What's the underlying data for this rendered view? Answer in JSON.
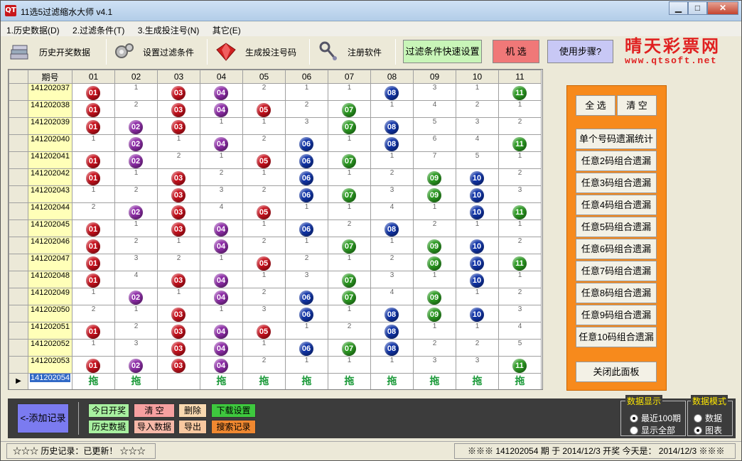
{
  "window": {
    "title": "11选5过滤缩水大师 v4.1",
    "min": "▁",
    "max": "□",
    "close": "✕",
    "app_icon": "QT"
  },
  "menu": [
    "1.历史数据(D)",
    "2.过滤条件(T)",
    "3.生成投注号(N)",
    "其它(E)"
  ],
  "toolbar": {
    "history": "历史开奖数据",
    "filter": "设置过滤条件",
    "generate": "生成投注号码",
    "register": "注册软件",
    "quick_filter": "过滤条件快速设置",
    "random": "机 选",
    "help": "使用步骤?",
    "colors": {
      "quick_filter": "#c8f5b8",
      "random": "#f07878",
      "help": "#c8c8f5"
    }
  },
  "brand": {
    "name": "晴天彩票网",
    "url": "www.qtsoft.net"
  },
  "grid": {
    "headers": [
      "期号",
      "01",
      "02",
      "03",
      "04",
      "05",
      "06",
      "07",
      "08",
      "09",
      "10",
      "11"
    ],
    "rows": [
      {
        "period": "141202037",
        "cells": [
          "01",
          "1",
          "03",
          "04",
          "2",
          "1",
          "1",
          "08",
          "3",
          "1",
          "11"
        ]
      },
      {
        "period": "141202038",
        "cells": [
          "01",
          "2",
          "03",
          "04",
          "05",
          "2",
          "07",
          "1",
          "4",
          "2",
          "1"
        ]
      },
      {
        "period": "141202039",
        "cells": [
          "01",
          "02",
          "03",
          "1",
          "1",
          "3",
          "07",
          "08",
          "5",
          "3",
          "2"
        ]
      },
      {
        "period": "141202040",
        "cells": [
          "1",
          "02",
          "1",
          "04",
          "2",
          "06",
          "1",
          "08",
          "6",
          "4",
          "11"
        ]
      },
      {
        "period": "141202041",
        "cells": [
          "01",
          "02",
          "2",
          "1",
          "05",
          "06",
          "07",
          "1",
          "7",
          "5",
          "1"
        ]
      },
      {
        "period": "141202042",
        "cells": [
          "01",
          "1",
          "03",
          "2",
          "1",
          "06",
          "1",
          "2",
          "09",
          "10",
          "2"
        ]
      },
      {
        "period": "141202043",
        "cells": [
          "1",
          "2",
          "03",
          "3",
          "2",
          "06",
          "07",
          "3",
          "09",
          "10",
          "3"
        ]
      },
      {
        "period": "141202044",
        "cells": [
          "2",
          "02",
          "03",
          "4",
          "05",
          "1",
          "1",
          "4",
          "1",
          "10",
          "11"
        ]
      },
      {
        "period": "141202045",
        "cells": [
          "01",
          "1",
          "03",
          "04",
          "1",
          "06",
          "2",
          "08",
          "2",
          "1",
          "1"
        ]
      },
      {
        "period": "141202046",
        "cells": [
          "01",
          "2",
          "1",
          "04",
          "2",
          "1",
          "07",
          "1",
          "09",
          "10",
          "2"
        ]
      },
      {
        "period": "141202047",
        "cells": [
          "01",
          "3",
          "2",
          "1",
          "05",
          "2",
          "1",
          "2",
          "09",
          "10",
          "11"
        ]
      },
      {
        "period": "141202048",
        "cells": [
          "01",
          "4",
          "03",
          "04",
          "1",
          "3",
          "07",
          "3",
          "1",
          "10",
          "1"
        ]
      },
      {
        "period": "141202049",
        "cells": [
          "1",
          "02",
          "1",
          "04",
          "2",
          "06",
          "07",
          "4",
          "09",
          "1",
          "2"
        ]
      },
      {
        "period": "141202050",
        "cells": [
          "2",
          "1",
          "03",
          "1",
          "3",
          "06",
          "1",
          "08",
          "09",
          "10",
          "3"
        ]
      },
      {
        "period": "141202051",
        "cells": [
          "01",
          "2",
          "03",
          "04",
          "05",
          "1",
          "2",
          "08",
          "1",
          "1",
          "4"
        ]
      },
      {
        "period": "141202052",
        "cells": [
          "1",
          "3",
          "03",
          "04",
          "1",
          "06",
          "07",
          "08",
          "2",
          "2",
          "5"
        ]
      },
      {
        "period": "141202053",
        "cells": [
          "01",
          "02",
          "03",
          "04",
          "2",
          "1",
          "1",
          "1",
          "3",
          "3",
          "11"
        ]
      }
    ],
    "current": {
      "period": "141202054",
      "marker": "▶",
      "cells": [
        "拖",
        "拖",
        "",
        "拖",
        "拖",
        "拖",
        "拖",
        "拖",
        "拖",
        "拖",
        "拖"
      ]
    },
    "ball_colors": {
      "01": "#c8101c",
      "02": "#8e2ca8",
      "03": "#c8101c",
      "04": "#8e2ca8",
      "05": "#c8101c",
      "06": "#1034a8",
      "07": "#2a9a20",
      "08": "#1034a8",
      "09": "#2a9a20",
      "10": "#1034a8",
      "11": "#2a9a20"
    }
  },
  "right_panel": {
    "select_all": "全 选",
    "clear": "清 空",
    "buttons": [
      "单个号码遗漏统计",
      "任意2码组合遗漏",
      "任意3码组合遗漏",
      "任意4码组合遗漏",
      "任意5码组合遗漏",
      "任意6码组合遗漏",
      "任意7码组合遗漏",
      "任意8码组合遗漏",
      "任意9码组合遗漏",
      "任意10码组合遗漏"
    ],
    "close": "关闭此面板"
  },
  "bottom": {
    "add": "<-添加记录",
    "today": "今日开奖",
    "clear": "清 空",
    "delete": "删除",
    "download": "下载设置",
    "history": "历史数据",
    "import": "导入数据",
    "export": "导出",
    "search": "搜索记录",
    "display_group": {
      "title": "数据显示",
      "opt1": "最近100期",
      "opt2": "显示全部",
      "selected": "最近100期"
    },
    "mode_group": {
      "title": "数据模式",
      "opt1": "数据",
      "opt2": "图表",
      "selected": "图表"
    }
  },
  "status": {
    "left": "☆☆☆  历史记录：已更新！ ☆☆☆",
    "right": "※※※  141202054 期 于 2014/12/3 开奖     今天是：  2014/12/3 ※※※"
  }
}
